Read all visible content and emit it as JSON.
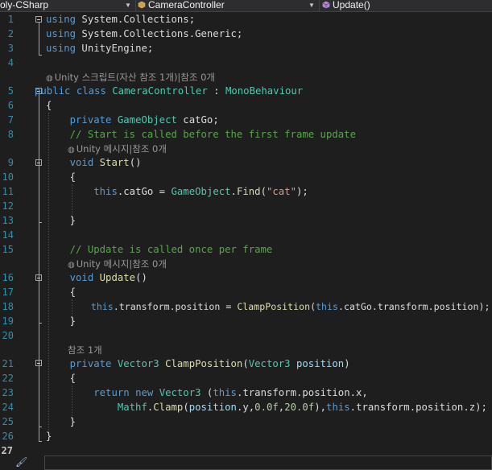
{
  "toolbar": {
    "project": "oly-CSharp",
    "class": "CameraController",
    "member": "Update()"
  },
  "lines": [
    {
      "n": "1",
      "t": "using System.Collections;"
    },
    {
      "n": "2",
      "t": "using System.Collections.Generic;"
    },
    {
      "n": "3",
      "t": "using UnityEngine;"
    },
    {
      "n": "4",
      "t": ""
    },
    {
      "n": "5",
      "t": "public class CameraController : MonoBehaviour"
    },
    {
      "n": "6",
      "t": "{"
    },
    {
      "n": "7",
      "t": "    private GameObject catGo;"
    },
    {
      "n": "8",
      "t": "    // Start is called before the first frame update"
    },
    {
      "n": "9",
      "t": "    void Start()"
    },
    {
      "n": "10",
      "t": "    {"
    },
    {
      "n": "11",
      "t": "        this.catGo = GameObject.Find(\"cat\");"
    },
    {
      "n": "12",
      "t": ""
    },
    {
      "n": "13",
      "t": "    }"
    },
    {
      "n": "14",
      "t": ""
    },
    {
      "n": "15",
      "t": "    // Update is called once per frame"
    },
    {
      "n": "16",
      "t": "    void Update()"
    },
    {
      "n": "17",
      "t": "    {"
    },
    {
      "n": "18",
      "t": "        this.transform.position = ClampPosition(this.catGo.transform.position);"
    },
    {
      "n": "19",
      "t": "    }"
    },
    {
      "n": "20",
      "t": ""
    },
    {
      "n": "21",
      "t": "    private Vector3 ClampPosition(Vector3 position)"
    },
    {
      "n": "22",
      "t": "    {"
    },
    {
      "n": "23",
      "t": "        return new Vector3 (this.transform.position.x,"
    },
    {
      "n": "24",
      "t": "            Mathf.Clamp(position.y,0.0f,20.0f),this.transform.position.z);"
    },
    {
      "n": "25",
      "t": "    }"
    },
    {
      "n": "26",
      "t": "}"
    },
    {
      "n": "27",
      "t": ""
    }
  ],
  "codelens": {
    "class": "Unity 스크립트(자산 참조 1개)|참조 0개",
    "start": "Unity 메시지|참조 0개",
    "update": "Unity 메시지|참조 0개",
    "clamp": "참조 1개"
  },
  "icons": {
    "class_icon": "csharp-class-icon",
    "member_icon": "method-icon",
    "lens_icon": "unity-icon",
    "margin_icon": "brush-icon"
  }
}
